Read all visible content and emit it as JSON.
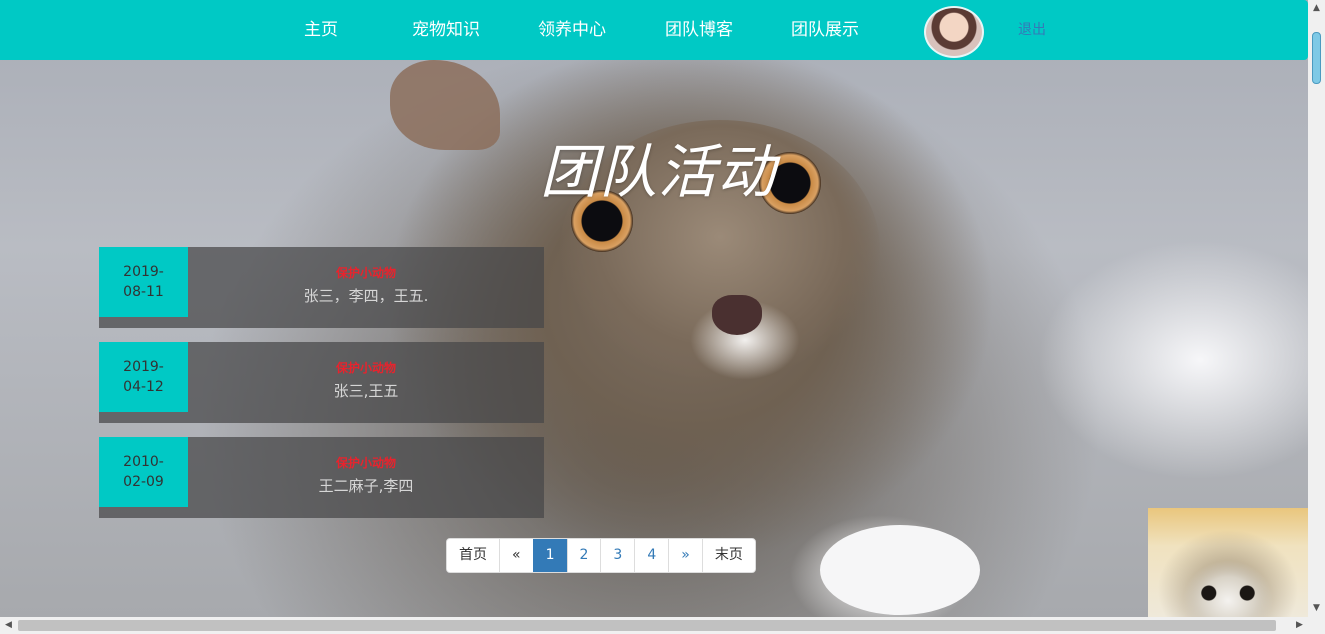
{
  "nav": {
    "items": [
      "主页",
      "宠物知识",
      "领养中心",
      "团队博客",
      "团队展示"
    ],
    "logout": "退出"
  },
  "section": {
    "title": "团队活动"
  },
  "activities": [
    {
      "date_line1": "2019-",
      "date_line2": "08-11",
      "tag": "保护小动物",
      "names": "张三，李四，王五."
    },
    {
      "date_line1": "2019-",
      "date_line2": "04-12",
      "tag": "保护小动物",
      "names": "张三,王五"
    },
    {
      "date_line1": "2010-",
      "date_line2": "02-09",
      "tag": "保护小动物",
      "names": "王二麻子,李四"
    }
  ],
  "pagination": {
    "first": "首页",
    "prev": "«",
    "pages": [
      "1",
      "2",
      "3",
      "4"
    ],
    "active_page": "1",
    "next": "»",
    "last": "末页"
  },
  "colors": {
    "accent": "#00c9c5",
    "link": "#337ab7",
    "tag": "#e8232d"
  }
}
